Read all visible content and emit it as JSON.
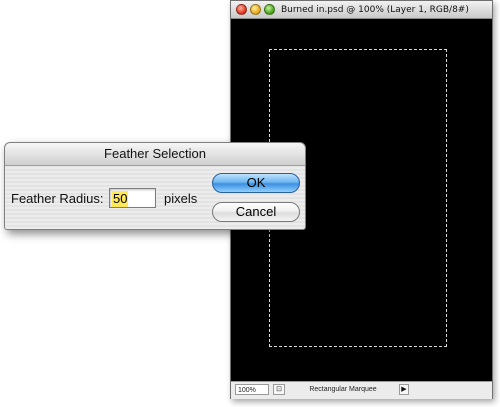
{
  "document_window": {
    "title": "Burned in.psd @ 100% (Layer 1, RGB/8#)",
    "statusbar": {
      "zoom": "100%",
      "info_icon": "document-info-icon",
      "tool": "Rectangular Marquee",
      "menu_arrow": "▶"
    }
  },
  "dialog": {
    "title": "Feather Selection",
    "field_label": "Feather Radius:",
    "radius_value": "50",
    "unit": "pixels",
    "ok_label": "OK",
    "cancel_label": "Cancel"
  },
  "colors": {
    "canvas": "#000000",
    "selection_highlight": "#ffe95a",
    "ok_button": "#4a98e6"
  }
}
